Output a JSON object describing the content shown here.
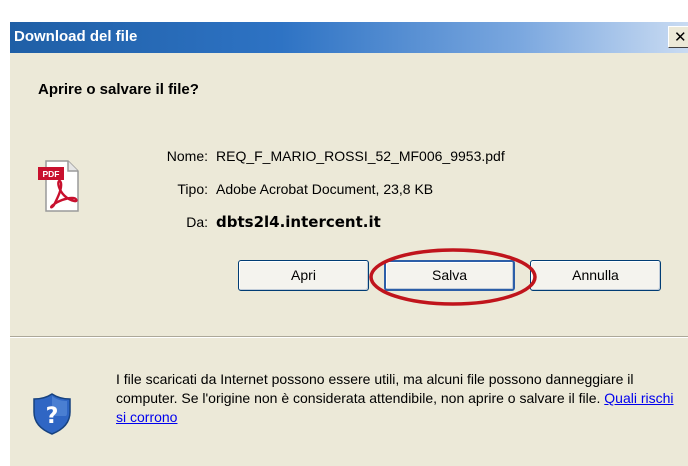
{
  "window": {
    "title": "Download del file",
    "close_glyph": "✕"
  },
  "heading": "Aprire o salvare il file?",
  "file": {
    "icon": "pdf-file-icon",
    "icon_label": "PDF",
    "name_label": "Nome:",
    "name_value": "REQ_F_MARIO_ROSSI_52_MF006_9953.pdf",
    "type_label": "Tipo:",
    "type_value": "Adobe Acrobat Document, 23,8 KB",
    "from_label": "Da:",
    "from_value": "dbts2l4.intercent.it"
  },
  "buttons": {
    "open": "Apri",
    "save": "Salva",
    "cancel": "Annulla"
  },
  "warning": {
    "icon": "shield-help-icon",
    "text": "I file scaricati da Internet possono essere utili, ma alcuni file possono danneggiare il computer. Se l'origine non è considerata attendibile, non aprire o salvare il file. ",
    "link": "Quali rischi si corrono"
  },
  "colors": {
    "titlebar": "#2e73c4",
    "dialog_bg": "#ece9d8",
    "annotation": "#c0141c",
    "link": "#0000ee"
  }
}
